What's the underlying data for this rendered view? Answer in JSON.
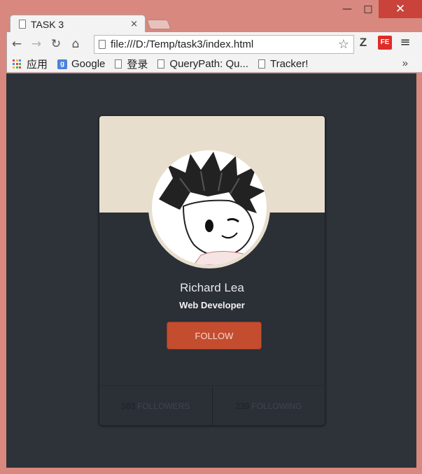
{
  "window": {
    "minimize_icon": "minimize-icon",
    "maximize_icon": "maximize-icon",
    "close_icon": "close-icon",
    "close_color": "#c9433b"
  },
  "tab": {
    "title": "TASK 3",
    "close": "×"
  },
  "toolbar": {
    "url": "file:///D:/Temp/task3/index.html",
    "star": "☆",
    "ext_z": "Z",
    "ext_fe": "FE",
    "menu": "≡"
  },
  "bookmarks": {
    "items": [
      {
        "label": "应用",
        "icon": "apps-grid-icon"
      },
      {
        "label": "Google",
        "icon": "google-icon"
      },
      {
        "label": "登录",
        "icon": "page-icon"
      },
      {
        "label": "QueryPath: Qu...",
        "icon": "page-icon"
      },
      {
        "label": "Tracker!",
        "icon": "page-icon"
      }
    ],
    "more": "»"
  },
  "profile": {
    "name": "Richard Lea",
    "role": "Web Developer",
    "follow_label": "FOLLOW",
    "followers_count": "383",
    "followers_label": "FOLLOWERS",
    "following_count": "239",
    "following_label": "FOLLOWING",
    "accent_color": "#c44d2f",
    "header_color": "#e7decd",
    "background_color": "#2e333a"
  }
}
